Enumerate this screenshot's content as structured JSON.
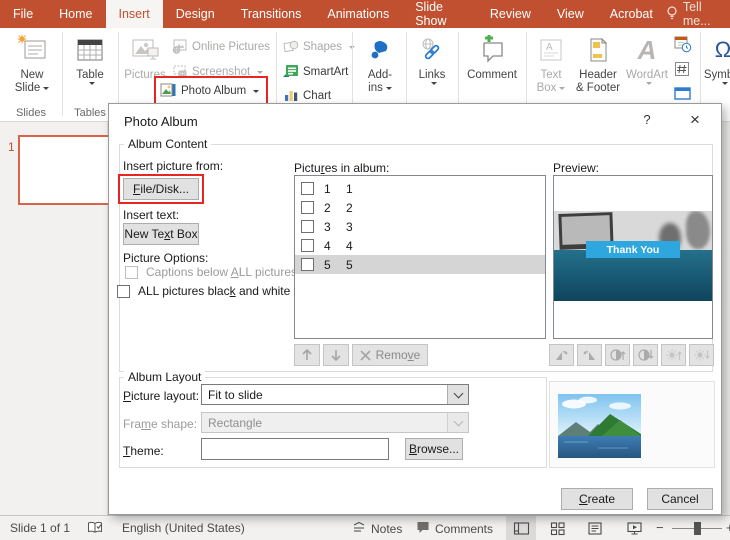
{
  "ribbon": {
    "tabs": [
      "File",
      "Home",
      "Insert",
      "Design",
      "Transitions",
      "Animations",
      "Slide Show",
      "Review",
      "View",
      "Acrobat"
    ],
    "tell_me": "Tell me...",
    "group_labels": {
      "slides": "Slides",
      "tables": "Tables"
    },
    "buttons": {
      "new_slide": {
        "line1": "New",
        "line2": "Slide"
      },
      "table": {
        "label": "Table"
      },
      "pictures": {
        "label": "Pictures"
      },
      "online_pictures": {
        "label": "Online Pictures"
      },
      "screenshot": {
        "label": "Screenshot"
      },
      "photo_album": {
        "label": "Photo Album"
      },
      "shapes": {
        "label": "Shapes"
      },
      "smartart": {
        "label": "SmartArt"
      },
      "chart": {
        "label": "Chart"
      },
      "add_ins": {
        "line1": "Add-",
        "line2": "ins"
      },
      "links": {
        "label": "Links"
      },
      "comment": {
        "label": "Comment"
      },
      "text_box": {
        "line1": "Text",
        "line2": "Box"
      },
      "header_footer": {
        "line1": "Header",
        "line2": "& Footer"
      },
      "wordart": {
        "label": "WordArt"
      },
      "symbol": {
        "label": "Symbol"
      }
    },
    "icon_glyphs": {
      "omega": "Ω",
      "wordart_a": "A",
      "textbox_a": "A"
    }
  },
  "slide_panel": {
    "slide_number": "1"
  },
  "dialog": {
    "title": "Photo Album",
    "help_glyph": "?",
    "close_glyph": "×",
    "album_content": {
      "group_label": "Album Content",
      "insert_picture_from": "Insert picture from:",
      "file_disk_button": {
        "pre": "",
        "key": "F",
        "post": "ile/Disk..."
      },
      "insert_text": "Insert text:",
      "new_text_box_button": {
        "pre": "New Te",
        "key": "x",
        "post": "t Box"
      },
      "picture_options": "Picture Options:",
      "captions_checkbox": {
        "pre": "Captions below ",
        "key": "A",
        "post": "LL pictures",
        "checked": false,
        "enabled": false
      },
      "bw_checkbox": {
        "pre": "ALL pictures blac",
        "key": "k",
        "post": " and white",
        "checked": false,
        "enabled": true
      },
      "pictures_in_album": {
        "pre": "Pictu",
        "key": "r",
        "post": "es in album:"
      },
      "pictures": [
        {
          "num": "1",
          "name": "1",
          "checked": false,
          "selected": false
        },
        {
          "num": "2",
          "name": "2",
          "checked": false,
          "selected": false
        },
        {
          "num": "3",
          "name": "3",
          "checked": false,
          "selected": false
        },
        {
          "num": "4",
          "name": "4",
          "checked": false,
          "selected": false
        },
        {
          "num": "5",
          "name": "5",
          "checked": false,
          "selected": true
        }
      ],
      "remove_button": {
        "pre": "Remo",
        "key": "v",
        "post": "e"
      },
      "preview_label": "Preview:",
      "preview_banner": "Thank You"
    },
    "album_layout": {
      "group_label": "Album Layout",
      "picture_layout_label": {
        "pre": "",
        "key": "P",
        "post": "icture layout:"
      },
      "picture_layout_value": "Fit to slide",
      "frame_shape_label": {
        "pre": "Fra",
        "key": "m",
        "post": "e shape:"
      },
      "frame_shape_value": "Rectangle",
      "theme_label": {
        "pre": "",
        "key": "T",
        "post": "heme:"
      },
      "theme_value": "",
      "browse_button": {
        "pre": "",
        "key": "B",
        "post": "rowse..."
      }
    },
    "create_button": {
      "pre": "",
      "key": "C",
      "post": "reate"
    },
    "cancel_button": "Cancel"
  },
  "status_bar": {
    "slide_indicator": "Slide 1 of 1",
    "language": "English (United States)",
    "notes_label": "Notes",
    "comments_label": "Comments",
    "zoom_minus": "−",
    "zoom_plus": "+"
  },
  "colors": {
    "ribbon_red": "#C0502F",
    "annotation_red": "#E8251F",
    "banner_blue": "#2EA7DF",
    "slide_selection_border": "#D9644A"
  }
}
